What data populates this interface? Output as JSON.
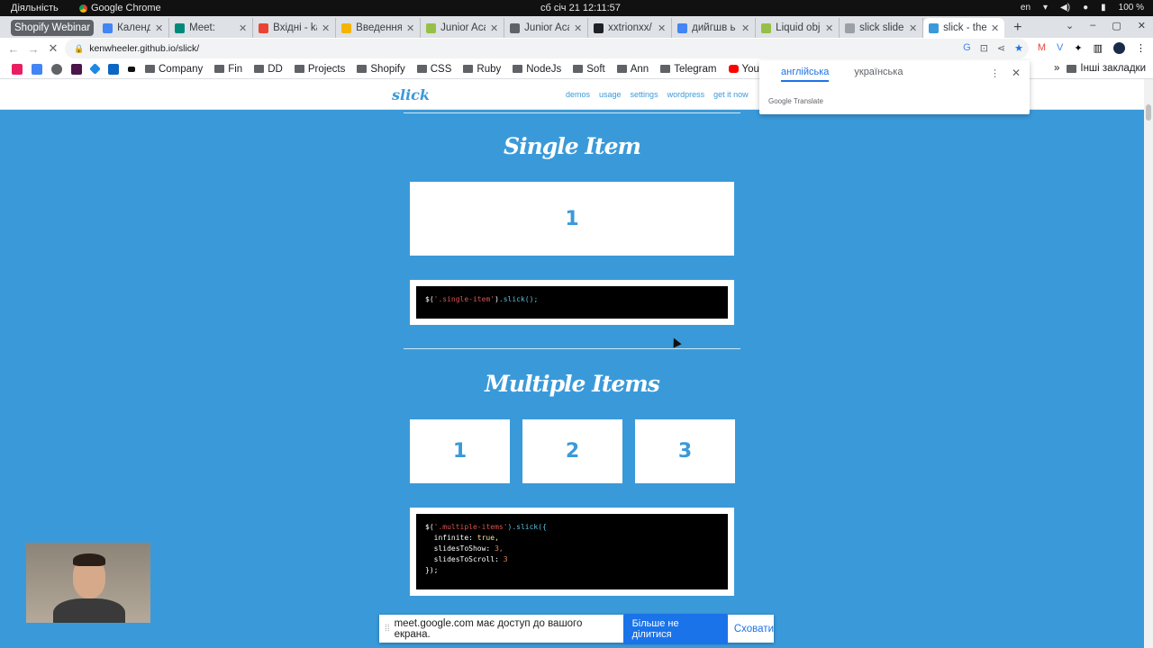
{
  "os_bar": {
    "activities": "Діяльність",
    "app_name": "Google Chrome",
    "clock": "сб січ 21  12:11:57",
    "input_lang": "en",
    "battery": "100 %"
  },
  "tabs": [
    {
      "label": "Shopify Webinar",
      "color": "#5f6368",
      "pinned": true
    },
    {
      "label": "Календар",
      "color": "#4285f4"
    },
    {
      "label": "Meet: ",
      "color": "#00897b"
    },
    {
      "label": "Вхідні - ka",
      "color": "#ea4335"
    },
    {
      "label": "Введення",
      "color": "#f4b400"
    },
    {
      "label": "Junior Aca",
      "color": "#95bf47"
    },
    {
      "label": "Junior Aca",
      "color": "#5f6368"
    },
    {
      "label": "xxtrionxx/",
      "color": "#202124"
    },
    {
      "label": "дийгшв ь",
      "color": "#4285f4"
    },
    {
      "label": "Liquid obj",
      "color": "#95bf47"
    },
    {
      "label": "slick slider",
      "color": "#9aa0a6"
    },
    {
      "label": "slick - the l",
      "color": "#3a9ad9",
      "active": true
    }
  ],
  "toolbar": {
    "url": "kenwheeler.github.io/slick/"
  },
  "bookmarks": {
    "folders": [
      "Company",
      "Fin",
      "DD",
      "Projects",
      "Shopify",
      "CSS",
      "Ruby",
      "NodeJs",
      "Soft",
      "Ann",
      "Telegram",
      "Youtube"
    ],
    "other": "Інші закладки"
  },
  "translate_popup": {
    "source_lang": "англійська",
    "target_lang": "українська",
    "brand": "Google Translate"
  },
  "site": {
    "logo": "slick",
    "nav": [
      "demos",
      "usage",
      "settings",
      "wordpress",
      "get it now"
    ],
    "single_item": {
      "title": "Single Item",
      "slide": "1",
      "code_sel": "'.single-item'",
      "code_call": ".slick();",
      "code_prefix": "$("
    },
    "multiple_items": {
      "title": "Multiple Items",
      "slides": [
        "1",
        "2",
        "3"
      ],
      "code_line1_prefix": "$(",
      "code_line1_sel": "'.multiple-items'",
      "code_line1_call": ").slick({",
      "code_line2_key": "  infinite: ",
      "code_line2_val": "true,",
      "code_line3_key": "  slidesToShow: ",
      "code_line3_val": "3,",
      "code_line4_key": "  slidesToScroll: ",
      "code_line4_val": "3",
      "code_line5": "});"
    }
  },
  "share_bar": {
    "message": "meet.google.com має доступ до вашого екрана.",
    "stop_label": "Більше не ділитися",
    "hide_label": "Сховати"
  }
}
